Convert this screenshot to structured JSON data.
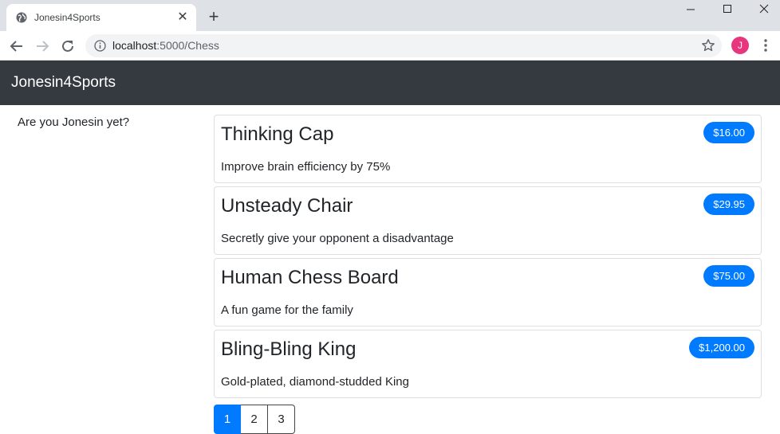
{
  "browser": {
    "tab_title": "Jonesin4Sports",
    "url_host": "localhost",
    "url_rest": ":5000/Chess",
    "profile_initial": "J",
    "profile_color": "#e8357d"
  },
  "navbar": {
    "brand": "Jonesin4Sports",
    "background": "#343a40"
  },
  "sidebar": {
    "tagline": "Are you Jonesin yet?"
  },
  "products": [
    {
      "name": "Thinking Cap",
      "price": "$16.00",
      "description": "Improve brain efficiency by 75%"
    },
    {
      "name": "Unsteady Chair",
      "price": "$29.95",
      "description": "Secretly give your opponent a disadvantage"
    },
    {
      "name": "Human Chess Board",
      "price": "$75.00",
      "description": "A fun game for the family"
    },
    {
      "name": "Bling-Bling King",
      "price": "$1,200.00",
      "description": "Gold-plated, diamond-studded King"
    }
  ],
  "pagination": {
    "pages": [
      "1",
      "2",
      "3"
    ],
    "current": "1"
  },
  "accent_color": "#007bff"
}
